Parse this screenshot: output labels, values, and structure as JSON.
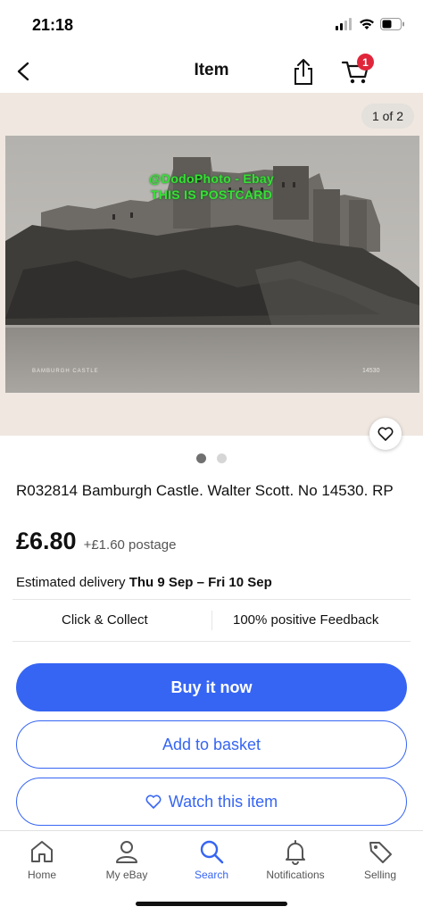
{
  "status_bar": {
    "time": "21:18",
    "icons": [
      "cellular-signal-icon",
      "wifi-icon",
      "battery-icon"
    ]
  },
  "nav": {
    "title": "Item",
    "cart_count": "1",
    "icons": [
      "back-arrow-icon",
      "share-icon",
      "cart-icon"
    ]
  },
  "gallery": {
    "counter": "1 of 2",
    "watermark_line1": "@DodoPhoto - Ebay",
    "watermark_line2": "THIS IS POSTCARD",
    "caption_left": "BAMBURGH CASTLE",
    "caption_right": "14530",
    "total_images": 2,
    "current_image": 1
  },
  "item": {
    "title": "R032814 Bamburgh Castle. Walter Scott. No 14530. RP",
    "price": "£6.80",
    "postage": "+£1.60 postage",
    "delivery_label": "Estimated delivery",
    "delivery_dates": "Thu 9 Sep – Fri 10 Sep"
  },
  "features": {
    "left": "Click & Collect",
    "right": "100% positive Feedback"
  },
  "actions": {
    "buy_now": "Buy it now",
    "add_to_basket": "Add to basket",
    "watch": "Watch this item"
  },
  "tabs": [
    {
      "label": "Home",
      "icon": "home-icon",
      "active": false
    },
    {
      "label": "My eBay",
      "icon": "person-icon",
      "active": false
    },
    {
      "label": "Search",
      "icon": "search-icon",
      "active": true
    },
    {
      "label": "Notifications",
      "icon": "bell-icon",
      "active": false
    },
    {
      "label": "Selling",
      "icon": "tag-icon",
      "active": false
    }
  ],
  "colors": {
    "accent": "#3665f3",
    "badge": "#e0253a",
    "watermark": "#37e037"
  }
}
